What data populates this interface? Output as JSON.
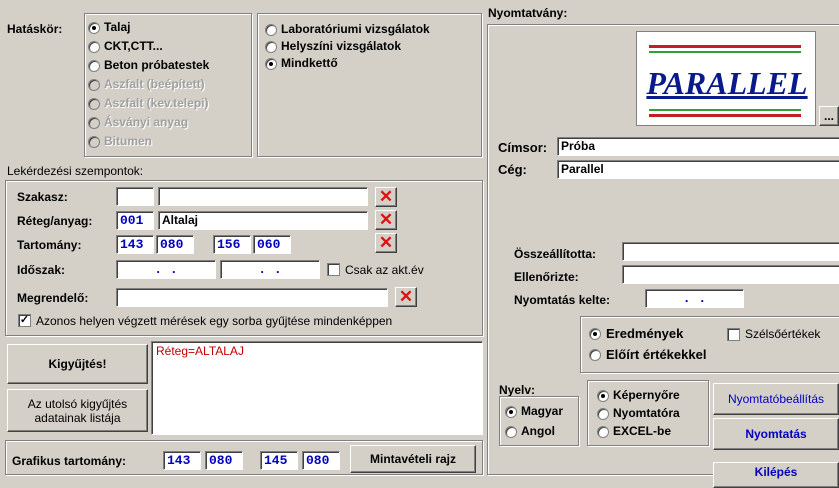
{
  "scope": {
    "label": "Hatáskör:",
    "options": [
      "Talaj",
      "CKT,CTT...",
      "Beton próbatestek",
      "Aszfalt (beépített)",
      "Aszfalt (kev.telepi)",
      "Ásványi anyag",
      "Bitumen"
    ],
    "selected": "Talaj"
  },
  "tests": {
    "options": [
      "Laboratóriumi vizsgálatok",
      "Helyszíni vizsgálatok",
      "Mindkettő"
    ],
    "selected": "Mindkettő"
  },
  "criteria": {
    "title": "Lekérdezési szempontok:",
    "section_label": "Szakasz:",
    "layer_label": "Réteg/anyag:",
    "layer_code": "001",
    "layer_name": "Altalaj",
    "range_label": "Tartomány:",
    "range": [
      "143",
      "080",
      "156",
      "060"
    ],
    "period_label": "Időszak:",
    "period_from": "  .  .  ",
    "period_to": "  .  .  ",
    "current_year_label": "Csak az akt.év",
    "client_label": "Megrendelő:",
    "same_place_label": "Azonos helyen végzett mérések egy sorba gyűjtése mindenképpen"
  },
  "actions": {
    "collect": "Kigyűjtés!",
    "last_list": "Az utolsó kigyűjtés adatainak listája"
  },
  "result_text": "Réteg=ALTALAJ",
  "graphic": {
    "label": "Grafikus tartomány:",
    "values": [
      "143",
      "080",
      "145",
      "080"
    ],
    "button": "Mintavételi rajz"
  },
  "print": {
    "title": "Nyomtatvány:",
    "logo_text": "PARALLEL",
    "browse": "...",
    "header_label": "Címsor:",
    "header_value": "Próba",
    "company_label": "Cég:",
    "company_value": "Parallel",
    "compiled_label": "Összeállította:",
    "checked_label": "Ellenőrizte:",
    "date_label": "Nyomtatás kelte:",
    "date_value": "  .  .  ",
    "results_options": [
      "Eredmények",
      "Előírt értékekkel"
    ],
    "results_selected": "Eredmények",
    "extreme_label": "Szélsőértékek",
    "lang_title": "Nyelv:",
    "lang_options": [
      "Magyar",
      "Angol"
    ],
    "lang_selected": "Magyar",
    "output_options": [
      "Képernyőre",
      "Nyomtatóra",
      "EXCEL-be"
    ],
    "output_selected": "Képernyőre",
    "printer_setup": "Nyomtatóbeállítás",
    "print_button": "Nyomtatás",
    "exit_button": "Kilépés"
  },
  "colors": {
    "accent": "#0000c0",
    "delete": "#e01010",
    "logo": "#0a1a8c"
  }
}
